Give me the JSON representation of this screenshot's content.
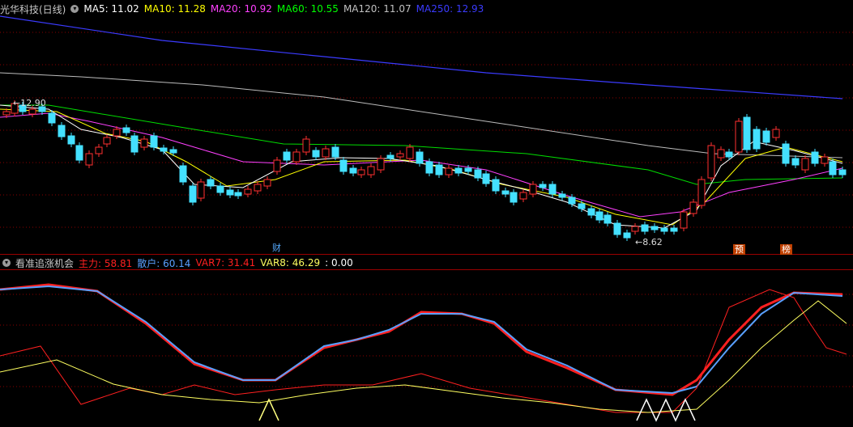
{
  "main": {
    "stock_title": "光华科技(日线)",
    "ma": [
      {
        "label": "MA5: 11.02",
        "color": "#ffffff"
      },
      {
        "label": "MA10: 11.28",
        "color": "#ffff00"
      },
      {
        "label": "MA20: 10.92",
        "color": "#ff40ff"
      },
      {
        "label": "MA60: 10.55",
        "color": "#00ff00"
      },
      {
        "label": "MA120: 11.07",
        "color": "#c0c0c0"
      },
      {
        "label": "MA250: 12.93",
        "color": "#3b3bff"
      }
    ],
    "high_label": "12.90",
    "low_label": "8.62",
    "markers": {
      "cai": "财",
      "yu": "预",
      "bang": "榜"
    }
  },
  "sub": {
    "title": "看准追涨机会",
    "items": [
      {
        "label": "主力: 58.81",
        "color": "#ff2020"
      },
      {
        "label": "散户: 60.14",
        "color": "#5aa0ff"
      },
      {
        "label": "VAR7: 31.41",
        "color": "#ff2020"
      },
      {
        "label": "VAR8: 46.29",
        "color": "#ffff60"
      },
      {
        "label": ": 0.00",
        "color": "#ffffff"
      }
    ]
  },
  "colors": {
    "up": "#ff3030",
    "down": "#44e0ff",
    "grid": "#8a0000",
    "border": "#9a0000"
  }
}
